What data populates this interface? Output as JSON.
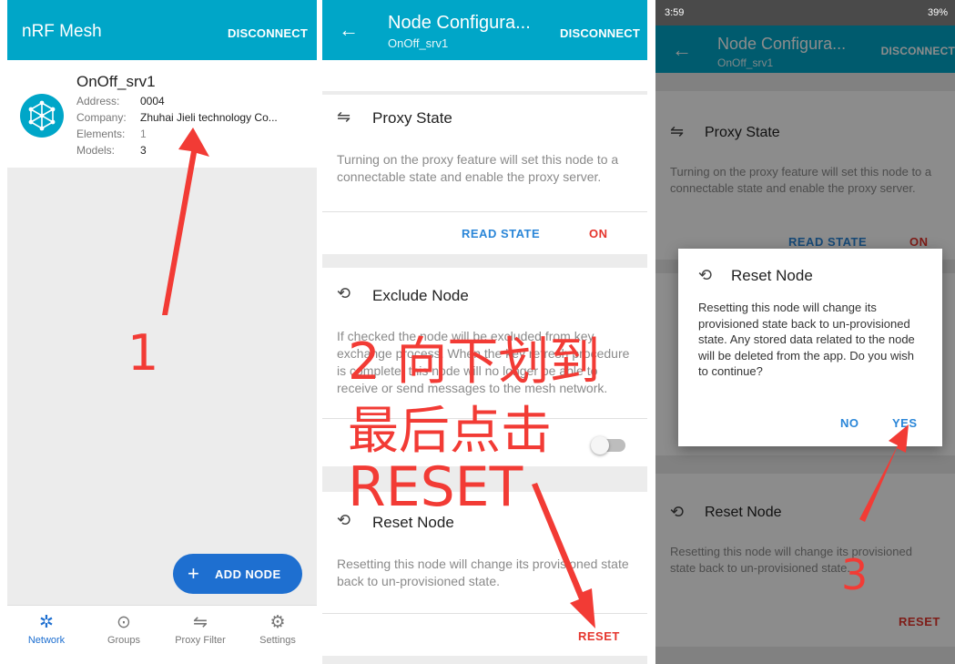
{
  "panel1": {
    "app_title": "nRF Mesh",
    "disconnect": "DISCONNECT",
    "node": {
      "name": "OnOff_srv1",
      "address_label": "Address:",
      "address_value": "0004",
      "company_label": "Company:",
      "company_value": "Zhuhai Jieli technology Co...",
      "elements_label": "Elements:",
      "elements_value": "1",
      "models_label": "Models:",
      "models_value": "3"
    },
    "fab_label": "ADD NODE",
    "nav": [
      {
        "label": "Network",
        "icon": "network-icon"
      },
      {
        "label": "Groups",
        "icon": "groups-icon"
      },
      {
        "label": "Proxy Filter",
        "icon": "filter-icon"
      },
      {
        "label": "Settings",
        "icon": "gear-icon"
      }
    ]
  },
  "panel2": {
    "title": "Node Configura...",
    "subtitle": "OnOff_srv1",
    "disconnect": "DISCONNECT",
    "proxy": {
      "title": "Proxy State",
      "desc": "Turning on the proxy feature will set this node to a connectable state and enable the proxy server.",
      "read_state": "READ STATE",
      "on": "ON"
    },
    "exclude": {
      "title": "Exclude Node",
      "desc": "If checked the node will be excluded from key exchange process. When the key refresh procedure is complete, this node will no longer be able to receive or send messages to the mesh network."
    },
    "reset": {
      "title": "Reset Node",
      "desc": "Resetting this node will change its provisioned state back to un-provisioned state.",
      "button": "RESET"
    }
  },
  "panel3": {
    "status_time": "3:59",
    "status_right": "39%",
    "title": "Node Configura...",
    "subtitle": "OnOff_srv1",
    "disconnect": "DISCONNECT",
    "proxy_title": "Proxy State",
    "proxy_desc": "Turning on the proxy feature will set this node to a connectable state and enable the proxy server.",
    "read_state": "READ STATE",
    "on": "ON",
    "dialog": {
      "title": "Reset Node",
      "message": "Resetting this node will change its provisioned state back to un-provisioned state. Any stored data related to the node will be deleted from the app. Do you wish to continue?",
      "no": "NO",
      "yes": "YES"
    },
    "reset_title": "Reset Node",
    "reset_desc": "Resetting this node will change its provisioned state back to un-provisioned state.",
    "reset_button": "RESET"
  },
  "annotations": {
    "step1": "1",
    "step2_line1": "2 向下划到",
    "step2_line2": "最后点击",
    "step2_line3": "RESET",
    "step3": "3"
  },
  "colors": {
    "appbar": "#00a6c8",
    "accent_blue": "#2a86d8",
    "fab": "#1e6fd0",
    "danger_red": "#e5352d",
    "annotation_red": "#f23b35"
  }
}
